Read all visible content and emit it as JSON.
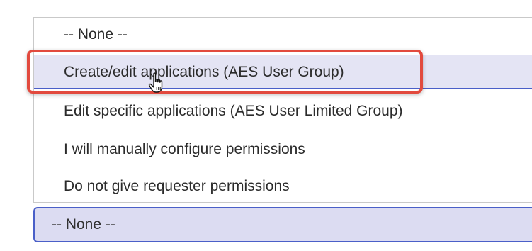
{
  "dropdown": {
    "options": [
      {
        "label": "-- None --"
      },
      {
        "label": "Create/edit applications (AES User Group)"
      },
      {
        "label": "Edit specific applications (AES User Limited Group)"
      },
      {
        "label": "I will manually configure permissions"
      },
      {
        "label": "Do not give requester permissions"
      }
    ],
    "hovered_option": "Create/edit applications (AES User Group)"
  },
  "select": {
    "selected_value": "-- None --"
  },
  "colors": {
    "highlight_border": "#e24a3e",
    "hover_background": "#e4e4f4",
    "select_background": "#dcdcf2",
    "accent_border": "#4a5fc8"
  },
  "icons": {
    "cursor": "hand-pointer-icon"
  }
}
